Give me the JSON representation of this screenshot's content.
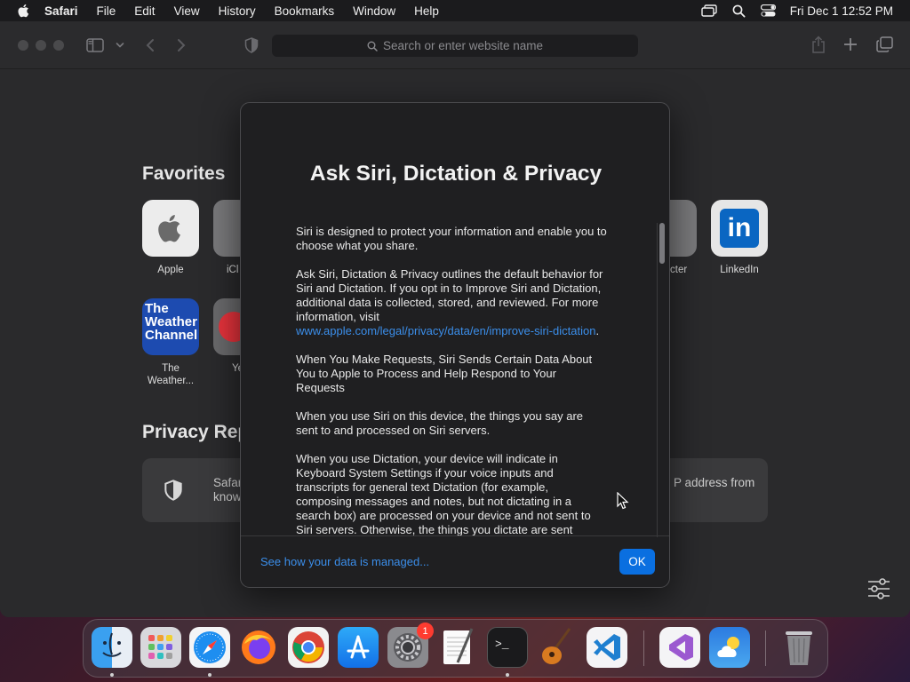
{
  "menubar": {
    "items": [
      "Safari",
      "File",
      "Edit",
      "View",
      "History",
      "Bookmarks",
      "Window",
      "Help"
    ],
    "clock": "Fri Dec 1  12:52 PM"
  },
  "toolbar": {
    "search_placeholder": "Search or enter website name"
  },
  "start_page": {
    "favorites_title": "Favorites",
    "favorites": [
      {
        "label": "Apple"
      },
      {
        "label": "iCl"
      },
      {
        "label": "cter"
      },
      {
        "label": "LinkedIn"
      },
      {
        "label": "The Weather..."
      },
      {
        "label": "Ye"
      }
    ],
    "weather_tile_text": [
      "The",
      "Weather",
      "Channel"
    ],
    "privacy_title": "Privacy Rep",
    "privacy_text_left": [
      "Safar",
      "know"
    ],
    "privacy_text_right": "P address from"
  },
  "modal": {
    "title": "Ask Siri, Dictation & Privacy",
    "paragraphs": [
      "Siri is designed to protect your information and enable you to choose what you share.",
      "Ask Siri, Dictation & Privacy outlines the default behavior for Siri and Dictation. If you opt in to Improve Siri and Dictation, additional data is collected, stored, and reviewed. For more information, visit",
      "www.apple.com/legal/privacy/data/en/improve-siri-dictation",
      "When You Make Requests, Siri Sends Certain Data About You to Apple to Process and Help Respond to Your Requests",
      "When you use Siri on this device, the things you say are sent to and processed on Siri servers.",
      "When you use Dictation, your device will indicate in Keyboard System Settings if your voice inputs and transcripts for general text Dictation (for example, composing messages and notes, but not dictating in a search box) are processed on your device and not sent to Siri servers. Otherwise, the things you dictate are sent"
    ],
    "footer_link": "See how your data is managed...",
    "ok_label": "OK"
  },
  "dock": {
    "badge_settings": "1",
    "apps": [
      "Finder",
      "Launchpad",
      "Safari",
      "Firefox",
      "Chrome",
      "App Store",
      "System Settings",
      "TextEdit",
      "Terminal",
      "GarageBand",
      "VS Code",
      "Visual Studio",
      "Weather",
      "Trash"
    ]
  },
  "colors": {
    "accent": "#0a6fe0",
    "link": "#3b8eea",
    "badge": "#ff3b30"
  }
}
